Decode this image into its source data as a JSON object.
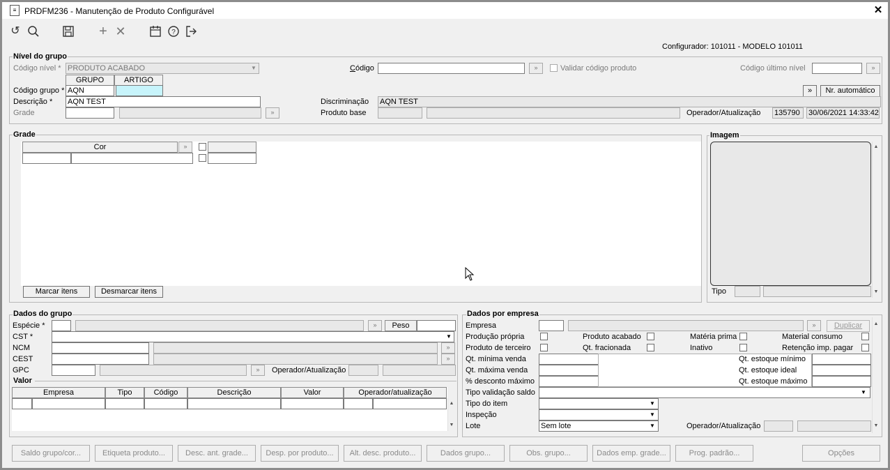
{
  "window": {
    "title": "PRDFM236 - Manutenção de Produto Configurável",
    "close_label": "✕"
  },
  "toolbar": {
    "icons": [
      "undo-icon",
      "search-icon",
      "save-icon",
      "add-icon",
      "delete-icon",
      "calendar-icon",
      "help-icon",
      "exit-icon"
    ]
  },
  "configurador": "Configurador: 101011 - MODELO 101011",
  "nivel": {
    "legend": "Nível do grupo",
    "codigo_nivel_label": "Código nível *",
    "codigo_nivel_value": "PRODUTO ACABADO",
    "codigo_label": "Código",
    "codigo_value": "",
    "validar_label": "Validar código produto",
    "codigo_ultimo_label": "Código último nível",
    "codigo_ultimo_value": "",
    "col_grupo": "GRUPO",
    "col_artigo": "ARTIGO",
    "codigo_grupo_label": "Código grupo *",
    "codigo_grupo_value": "AQN",
    "artigo_value": "",
    "descricao_label": "Descrição *",
    "descricao_value": "AQN TEST",
    "grade_label": "Grade",
    "discriminacao_label": "Discriminação",
    "discriminacao_value": "AQN TEST",
    "produto_base_label": "Produto base",
    "operador_label": "Operador/Atualização",
    "operador_value": "135790",
    "data_value": "30/06/2021 14:33:42",
    "btn_arrow": "»",
    "btn_nr_auto": "Nr. automático"
  },
  "grade": {
    "legend": "Grade",
    "col_cor": "Cor",
    "btn_marcar": "Marcar itens",
    "btn_desmarcar": "Desmarcar itens"
  },
  "imagem": {
    "legend": "Imagem",
    "tipo_label": "Tipo"
  },
  "dados_grupo": {
    "legend": "Dados do grupo",
    "especie_label": "Espécie *",
    "peso_label": "Peso",
    "cst_label": "CST *",
    "ncm_label": "NCM",
    "cest_label": "CEST",
    "gpc_label": "GPC",
    "operador_label": "Operador/Atualização"
  },
  "valor": {
    "legend": "Valor",
    "columns": [
      "Empresa",
      "Tipo",
      "Código",
      "Descrição",
      "Valor",
      "Operador/atualização"
    ]
  },
  "dados_empresa": {
    "legend": "Dados por empresa",
    "empresa_label": "Empresa",
    "btn_duplicar": "Duplicar",
    "producao_propria": "Produção própria",
    "produto_acabado": "Produto acabado",
    "materia_prima": "Matéria prima",
    "material_consumo": "Material consumo",
    "produto_terceiro": "Produto de terceiro",
    "qt_fracionada": "Qt. fracionada",
    "inativo": "Inativo",
    "retencao": "Retenção imp. pagar",
    "qt_min_venda": "Qt. mínima venda",
    "qt_max_venda": "Qt. máxima venda",
    "desc_max": "% desconto máximo",
    "qt_est_min": "Qt. estoque mínimo",
    "qt_est_ideal": "Qt. estoque ideal",
    "qt_est_max": "Qt. estoque máximo",
    "tipo_validacao": "Tipo validação saldo",
    "tipo_item": "Tipo do item",
    "inspecao": "Inspeção",
    "lote": "Lote",
    "lote_value": "Sem lote",
    "operador_label": "Operador/Atualização"
  },
  "bottom_buttons": [
    "Saldo grupo/cor...",
    "Etiqueta produto...",
    "Desc. ant. grade...",
    "Desp. por produto...",
    "Alt. desc. produto...",
    "Dados grupo...",
    "Obs. grupo...",
    "Dados emp. grade...",
    "Prog. padrão...",
    "Opções"
  ]
}
